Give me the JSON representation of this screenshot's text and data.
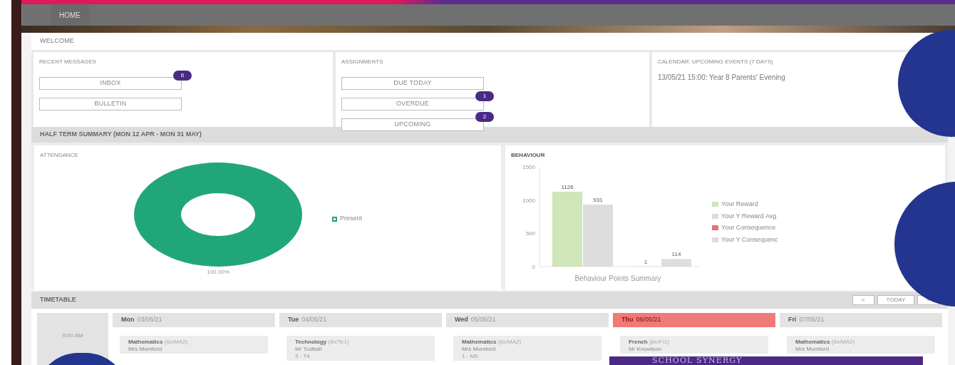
{
  "nav": {
    "items": [
      {
        "label": "HOME",
        "selected": true
      }
    ]
  },
  "welcome": {
    "title": "WELCOME",
    "messages": {
      "title": "RECENT MESSAGES",
      "buttons": [
        {
          "label": "INBOX",
          "badge": "6"
        },
        {
          "label": "BULLETIN"
        }
      ]
    },
    "assignments": {
      "title": "ASSIGNMENTS",
      "buttons": [
        {
          "label": "DUE TODAY"
        },
        {
          "label": "OVERDUE",
          "badge": "1"
        },
        {
          "label": "UPCOMING",
          "badge": "2"
        }
      ]
    },
    "calendar": {
      "title": "CALENDAR: UPCOMING EVENTS (7 DAYS)",
      "events": [
        "13/05/21 15:00: Year 8 Parents' Evening"
      ]
    }
  },
  "summary": {
    "title": "HALF TERM SUMMARY (MON 12 APR - MON 31 MAY)",
    "attendance": {
      "title": "ATTENDANCE",
      "value_label": "100.00%",
      "legend": [
        {
          "label": "Present",
          "color": "#21a67a"
        }
      ]
    },
    "behaviour": {
      "title": "BEHAVIOUR",
      "chart_data": {
        "type": "bar",
        "categories": [
          "Behaviour Points Summary"
        ],
        "series": [
          {
            "name": "Your Reward",
            "color": "#cfe6b8",
            "values": [
              1126
            ]
          },
          {
            "name": "Your Y Reward Avg",
            "color": "#dddddd",
            "values": [
              931
            ]
          },
          {
            "name": "Your Consequence",
            "color": "#e57373",
            "values": [
              1
            ]
          },
          {
            "name": "Your Y Consequenc",
            "color": "#dddddd",
            "values": [
              114
            ]
          }
        ],
        "ylim": [
          0,
          1500
        ],
        "yticks": [
          0,
          500,
          1000,
          1500
        ],
        "data_labels": true
      }
    }
  },
  "timetable": {
    "title": "TIMETABLE",
    "controls": [
      "<",
      "TODAY",
      ">"
    ],
    "time": "9:00 AM",
    "days": [
      {
        "day": "Mon",
        "date": "03/05/21",
        "selected": false,
        "lesson": {
          "subject": "Mathematics",
          "group": "(8x/MA2)",
          "teacher": "Mrs Mumford"
        }
      },
      {
        "day": "Tue",
        "date": "04/05/21",
        "selected": false,
        "lesson": {
          "subject": "Technology",
          "group": "(8x/Te1)",
          "teacher": "Mr Tudball",
          "room": "3 - T4"
        }
      },
      {
        "day": "Wed",
        "date": "05/05/21",
        "selected": false,
        "lesson": {
          "subject": "Mathematics",
          "group": "(8x/MA2)",
          "teacher": "Mrs Mumford",
          "room": "1 - M0"
        }
      },
      {
        "day": "Thu",
        "date": "06/05/21",
        "selected": true,
        "lesson": {
          "subject": "French",
          "group": "(8x/Fr1)",
          "teacher": "Mr Knowlson"
        }
      },
      {
        "day": "Fri",
        "date": "07/05/21",
        "selected": false,
        "lesson": {
          "subject": "Mathematics",
          "group": "(8x/MA2)",
          "teacher": "Mrs Mumford"
        }
      }
    ]
  },
  "banner": {
    "title": "SCHOOL SYNERGY"
  }
}
